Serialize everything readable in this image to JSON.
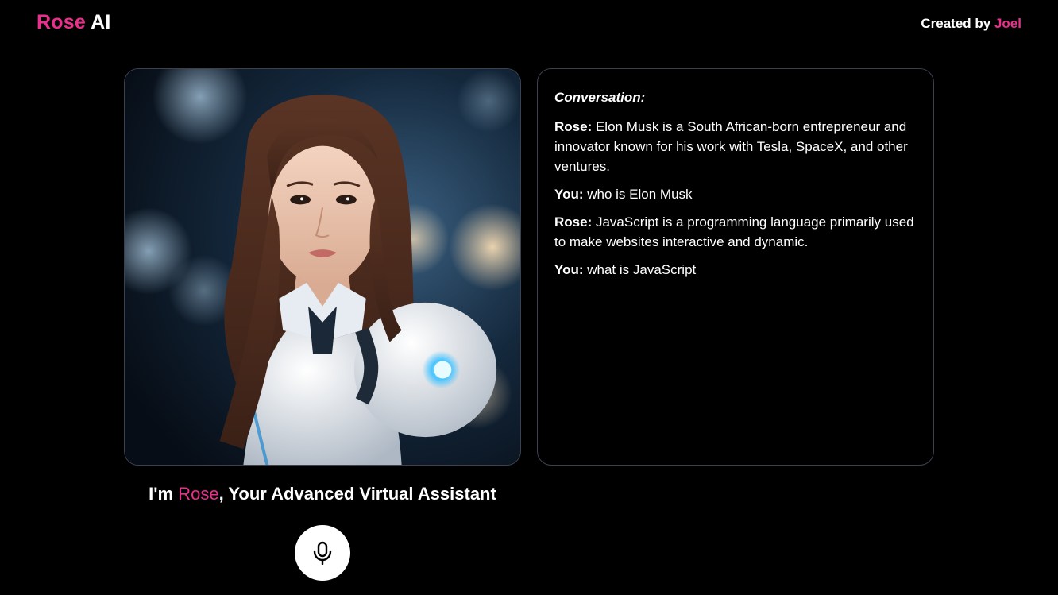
{
  "header": {
    "brand_first": "Rose",
    "brand_second": "AI",
    "credit_prefix": "Created by",
    "credit_name": "Joel"
  },
  "colors": {
    "accent": "#ec2e8c",
    "background": "#000000",
    "card_border": "#3b4150"
  },
  "avatar": {
    "description_icon": "robot-woman-portrait"
  },
  "conversation": {
    "title": "Conversation:",
    "messages": [
      {
        "speaker": "Rose:",
        "text": "Elon Musk is a South African-born entrepreneur and innovator known for his work with Tesla, SpaceX, and other ventures."
      },
      {
        "speaker": "You:",
        "text": "who is Elon Musk"
      },
      {
        "speaker": "Rose:",
        "text": "JavaScript is a programming language primarily used to make websites interactive and dynamic."
      },
      {
        "speaker": "You:",
        "text": "what is JavaScript"
      }
    ]
  },
  "tagline": {
    "prefix": "I'm",
    "name": "Rose",
    "suffix": ", Your Advanced Virtual Assistant"
  },
  "mic": {
    "icon": "microphone-icon"
  }
}
